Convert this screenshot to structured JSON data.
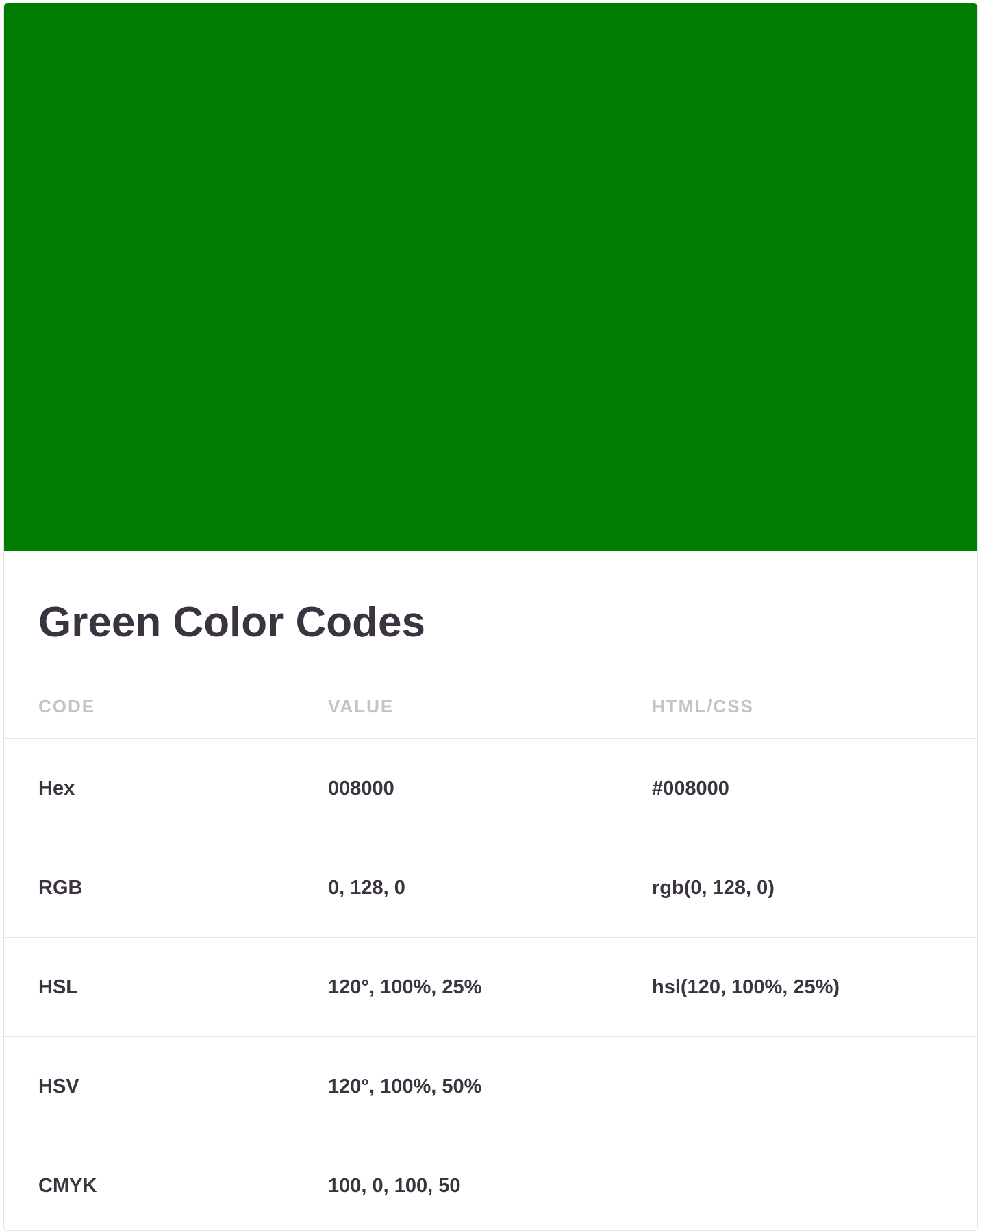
{
  "swatch": {
    "color": "#007c00"
  },
  "title": "Green Color Codes",
  "table": {
    "headers": [
      "CODE",
      "VALUE",
      "HTML/CSS"
    ],
    "rows": [
      {
        "code": "Hex",
        "value": "008000",
        "css": "#008000"
      },
      {
        "code": "RGB",
        "value": "0, 128, 0",
        "css": "rgb(0, 128, 0)"
      },
      {
        "code": "HSL",
        "value": "120°, 100%, 25%",
        "css": "hsl(120, 100%, 25%)"
      },
      {
        "code": "HSV",
        "value": "120°, 100%, 50%",
        "css": ""
      },
      {
        "code": "CMYK",
        "value": "100, 0, 100, 50",
        "css": ""
      }
    ]
  }
}
